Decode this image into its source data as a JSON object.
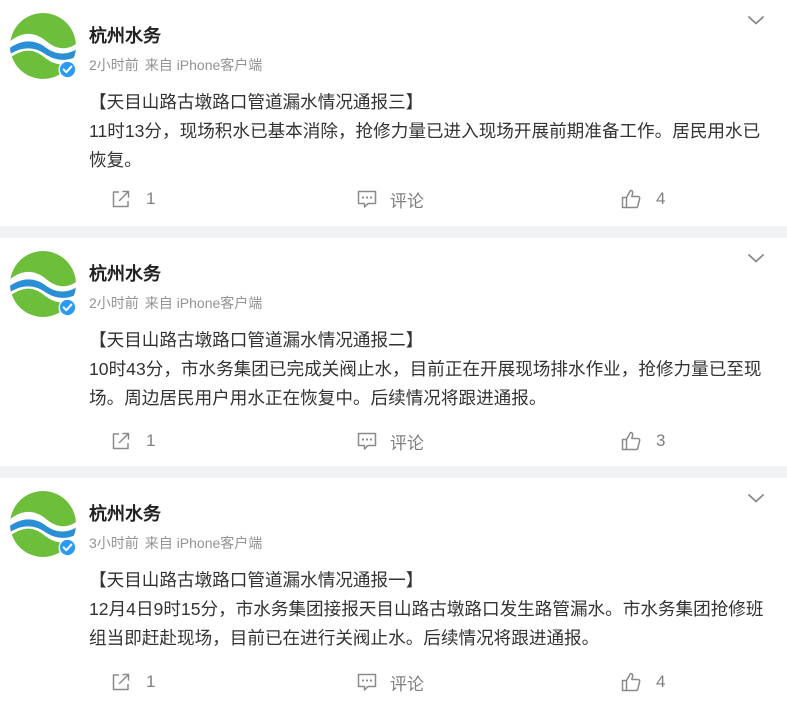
{
  "posts": [
    {
      "author": "杭州水务",
      "time": "2小时前",
      "source": "来自 iPhone客户端",
      "title": "【天目山路古墩路口管道漏水情况通报三】",
      "body": "11时13分，现场积水已基本消除，抢修力量已进入现场开展前期准备工作。居民用水已恢复。",
      "reposts": "1",
      "comment_label": "评论",
      "likes": "4"
    },
    {
      "author": "杭州水务",
      "time": "2小时前",
      "source": "来自 iPhone客户端",
      "title": "【天目山路古墩路口管道漏水情况通报二】",
      "body": "10时43分，市水务集团已完成关阀止水，目前正在开展现场排水作业，抢修力量已至现场。周边居民用户用水正在恢复中。后续情况将跟进通报。",
      "reposts": "1",
      "comment_label": "评论",
      "likes": "3"
    },
    {
      "author": "杭州水务",
      "time": "3小时前",
      "source": "来自 iPhone客户端",
      "title": "【天目山路古墩路口管道漏水情况通报一】",
      "body": "12月4日9时15分，市水务集团接报天目山路古墩路口发生路管漏水。市水务集团抢修班组当即赶赴现场，目前已在进行关阀止水。后续情况将跟进通报。",
      "reposts": "1",
      "comment_label": "评论",
      "likes": "4"
    }
  ],
  "icons": {
    "avatar": "hangzhou-water-logo",
    "verified": "verified-badge-icon",
    "menu": "chevron-down-icon",
    "repost": "share-icon",
    "comment": "comment-icon",
    "like": "thumbs-up-icon"
  },
  "colors": {
    "logo_green": "#6dbf3b",
    "logo_blue": "#2b8fd6",
    "verified": "#2a9bf3",
    "meta_text": "#939393",
    "action_text": "#808080",
    "background": "#f1f2f5"
  }
}
